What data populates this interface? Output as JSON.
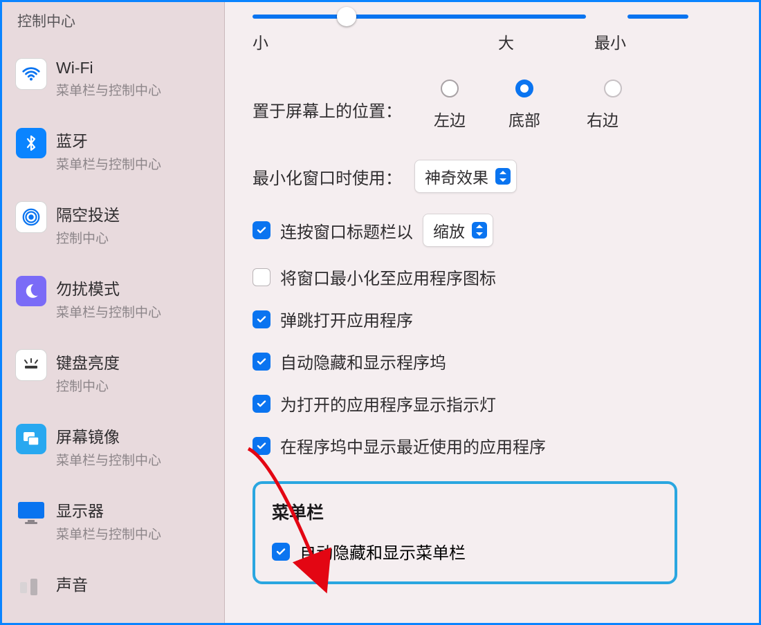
{
  "sidebar": {
    "title": "控制中心",
    "items": [
      {
        "name": "Wi-Fi",
        "sub": "菜单栏与控制中心"
      },
      {
        "name": "蓝牙",
        "sub": "菜单栏与控制中心"
      },
      {
        "name": "隔空投送",
        "sub": "控制中心"
      },
      {
        "name": "勿扰模式",
        "sub": "菜单栏与控制中心"
      },
      {
        "name": "键盘亮度",
        "sub": "控制中心"
      },
      {
        "name": "屏幕镜像",
        "sub": "菜单栏与控制中心"
      },
      {
        "name": "显示器",
        "sub": "菜单栏与控制中心"
      },
      {
        "name": "声音",
        "sub": ""
      }
    ]
  },
  "main": {
    "slider_labels": {
      "small": "小",
      "large": "大",
      "min": "最小"
    },
    "position": {
      "label": "置于屏幕上的位置：",
      "options": {
        "left": "左边",
        "bottom": "底部",
        "right": "右边"
      },
      "selected": "bottom"
    },
    "minimize": {
      "label": "最小化窗口时使用：",
      "value": "神奇效果"
    },
    "checks": {
      "c1": {
        "label": "连按窗口标题栏以",
        "dd": "缩放",
        "checked": true
      },
      "c2": {
        "label": "将窗口最小化至应用程序图标",
        "checked": false
      },
      "c3": {
        "label": "弹跳打开应用程序",
        "checked": true
      },
      "c4": {
        "label": "自动隐藏和显示程序坞",
        "checked": true
      },
      "c5": {
        "label": "为打开的应用程序显示指示灯",
        "checked": true
      },
      "c6": {
        "label": "在程序坞中显示最近使用的应用程序",
        "checked": true
      }
    },
    "menubar": {
      "title": "菜单栏",
      "autohide": {
        "label": "自动隐藏和显示菜单栏",
        "checked": true
      }
    }
  }
}
